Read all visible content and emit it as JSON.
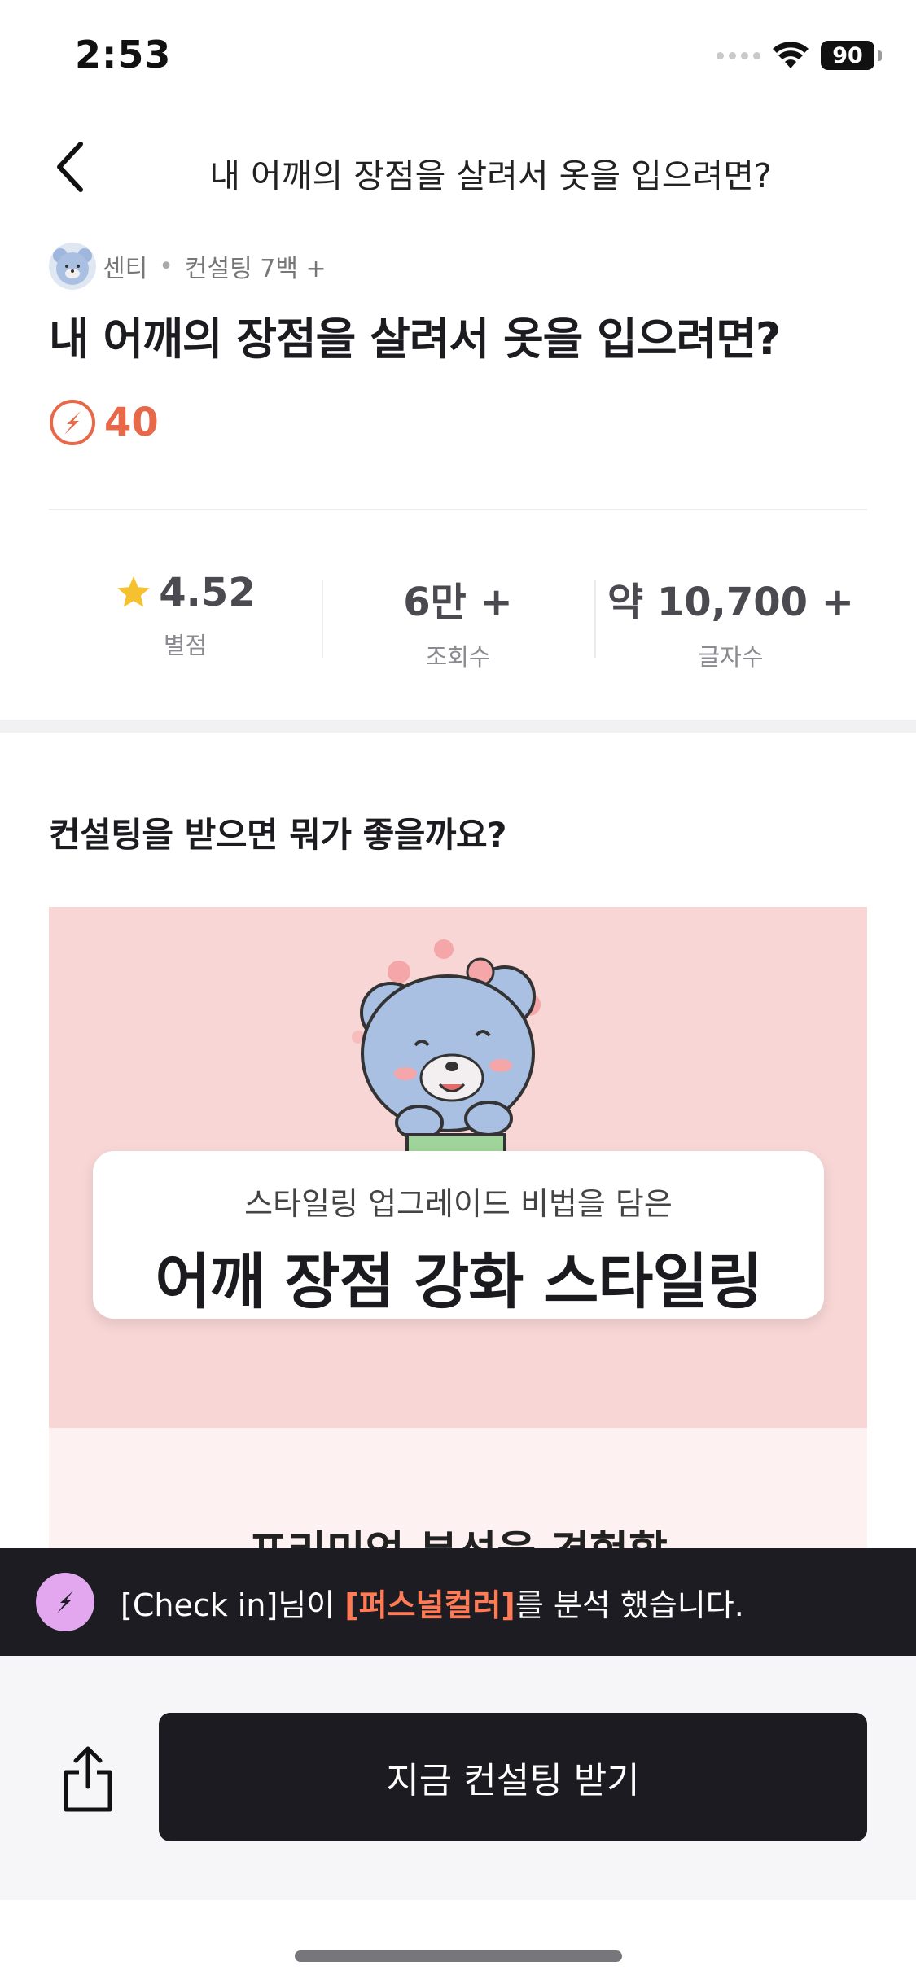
{
  "status_bar": {
    "time": "2:53",
    "battery": "90"
  },
  "nav": {
    "title": "내 어깨의 장점을 살려서 옷을 입으려면?"
  },
  "author": {
    "name": "센티",
    "consult_count": "컨설팅 7백 +"
  },
  "post": {
    "title": "내 어깨의 장점을 살려서 옷을 입으려면?",
    "points": "40"
  },
  "stats": [
    {
      "value": "4.52",
      "label": "별점"
    },
    {
      "value": "6만 +",
      "label": "조회수"
    },
    {
      "value": "약 10,700 +",
      "label": "글자수"
    }
  ],
  "section": {
    "heading": "컨설팅을 받으면 뭐가 좋을까요?"
  },
  "banner": {
    "subtitle": "스타일링 업그레이드 비법을 담은",
    "title": "어깨 장점 강화 스타일링",
    "lower_text": "프리미엄 분석을 경험할"
  },
  "notice": {
    "prefix": "[Check in]님이 ",
    "highlight": "[퍼스널컬러]",
    "suffix": "를 분석 했습니다."
  },
  "cta": {
    "label": "지금 컨설팅 받기"
  },
  "colors": {
    "accent": "#e8684a",
    "highlight": "#ff7a55",
    "banner_bg": "#f7d6d5",
    "dark": "#1b1b21"
  }
}
